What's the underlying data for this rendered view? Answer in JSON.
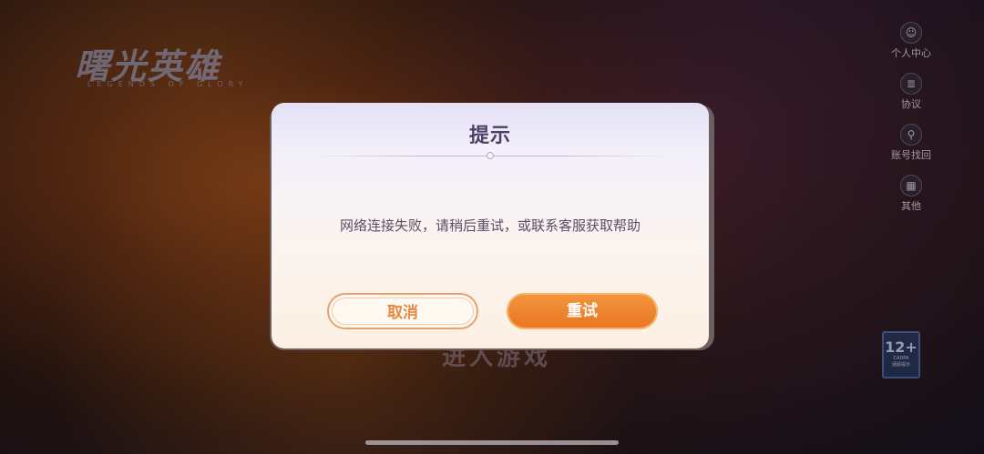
{
  "logo": {
    "title": "曙光英雄",
    "subtitle": "LEGENDS OF GLORY"
  },
  "side_menu": [
    {
      "label": "个人中心",
      "icon": "person-icon"
    },
    {
      "label": "协议",
      "icon": "document-icon"
    },
    {
      "label": "账号找回",
      "icon": "account-search-icon"
    },
    {
      "label": "其他",
      "icon": "grid-icon"
    }
  ],
  "age_badge": {
    "rating": "12+",
    "sub": "CADPA",
    "note": "适龄提示"
  },
  "enter_game": "进入游戏",
  "dialog": {
    "title": "提示",
    "message": "网络连接失败，请稍后重试，或联系客服获取帮助",
    "cancel_label": "取消",
    "retry_label": "重试"
  }
}
